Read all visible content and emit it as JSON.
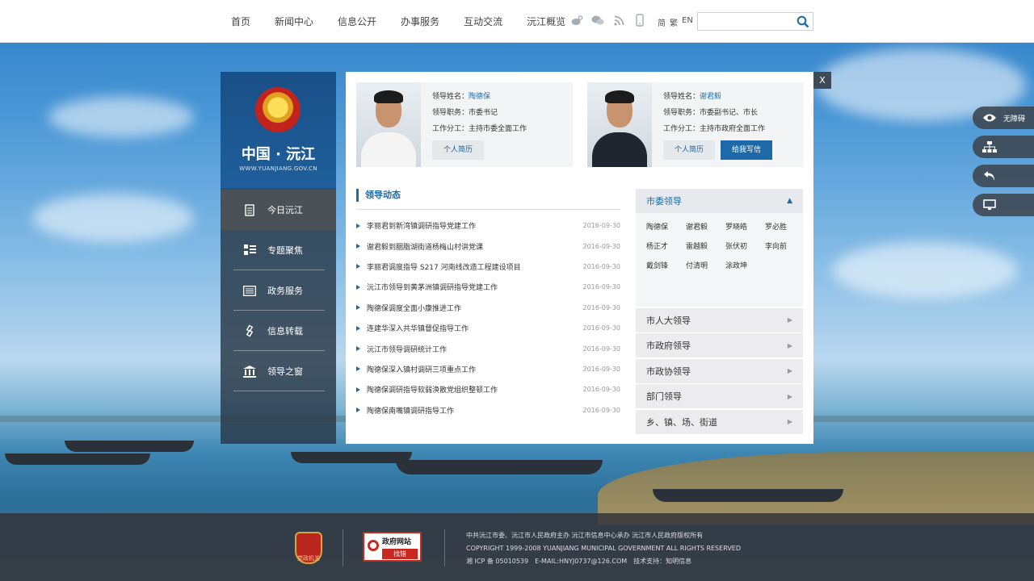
{
  "nav": {
    "items": [
      "首页",
      "新闻中心",
      "信息公开",
      "办事服务",
      "互动交流",
      "沅江概览"
    ],
    "lang": [
      "简",
      "繁",
      "EN"
    ],
    "search_placeholder": ""
  },
  "side": {
    "title": "中国 · 沅江",
    "url": "WWW.YUANJIANG.GOV.CN",
    "menu": [
      "今日沅江",
      "专题聚焦",
      "政务服务",
      "信息转载",
      "领导之窗"
    ]
  },
  "close_label": "X",
  "leaders": [
    {
      "name_label": "领导姓名：",
      "name": "陶德保",
      "post": "领导职务：市委书记",
      "duty": "工作分工：主持市委全面工作",
      "btn_resume": "个人简历"
    },
    {
      "name_label": "领导姓名：",
      "name": "谢君毅",
      "post": "领导职务：市委副书记、市长",
      "duty": "工作分工：主持市政府全面工作",
      "btn_resume": "个人简历",
      "btn_letter": "给我写信"
    }
  ],
  "news": {
    "title": "领导动态",
    "items": [
      {
        "t": "李丽君到新湾镇调研指导党建工作",
        "d": "2016-09-30"
      },
      {
        "t": "谢君毅到胭脂湖街道杨梅山村讲党课",
        "d": "2016-09-30"
      },
      {
        "t": "李丽君调度指导 S217 河南线改造工程建设项目",
        "d": "2016-09-30"
      },
      {
        "t": "沅江市领导到黄茅洲镇调研指导党建工作",
        "d": "2016-09-30"
      },
      {
        "t": "陶德保调度全面小康推进工作",
        "d": "2016-09-30"
      },
      {
        "t": "连建华深入共华镇督促指导工作",
        "d": "2016-09-30"
      },
      {
        "t": "沅江市领导调研统计工作",
        "d": "2016-09-30"
      },
      {
        "t": "陶德保深入镇村调研三项重点工作",
        "d": "2016-09-30"
      },
      {
        "t": "陶德保调研指导软弱涣散党组织整顿工作",
        "d": "2016-09-30"
      },
      {
        "t": "陶德保南嘴镇调研指导工作",
        "d": "2016-09-30"
      }
    ]
  },
  "right": {
    "head": "市委领导",
    "names": [
      "陶德保",
      "谢君毅",
      "罗晓皓",
      "罗必胜",
      "杨正才",
      "雷越毅",
      "张伏初",
      "李向前",
      "戴剑锋",
      "付清明",
      "涂政坤"
    ],
    "groups": [
      "市人大领导",
      "市政府领导",
      "市政协领导",
      "部门领导",
      "乡、镇、场、街道"
    ]
  },
  "float": {
    "accessibility": "无障碍"
  },
  "footer": {
    "badge1": "党政机关",
    "badge2_title": "政府网站",
    "badge2_sub": "找错",
    "line1": "中共沅江市委、沅江市人民政府主办 沅江市信息中心承办 沅江市人民政府版权所有",
    "line2": "COPYRIGHT 1999-2008 YUANJIANG MUNICIPAL GOVERNMENT ALL RIGHTS RESERVED",
    "line3": "湘 ICP 备 05010539　E-MAIL:HNYJ0737@126.COM　技术支持：知明信息"
  }
}
